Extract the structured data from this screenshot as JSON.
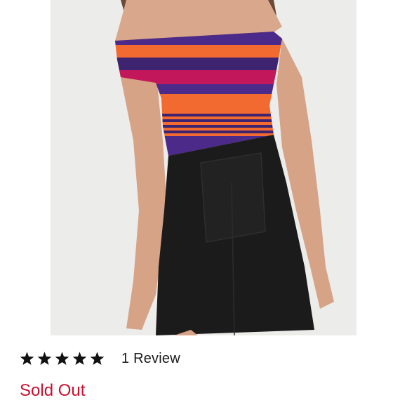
{
  "listing": {
    "product_image": "striped-off-shoulder-top-black-mini-skirt-photo",
    "rating": {
      "stars_filled": 5,
      "stars_total": 5,
      "review_count_label": "1 Review"
    },
    "status_label": "Sold Out"
  },
  "colors": {
    "status": "#c8102e",
    "star": "#111111",
    "text": "#1a1a1a",
    "photo_background": "#ececeb"
  }
}
